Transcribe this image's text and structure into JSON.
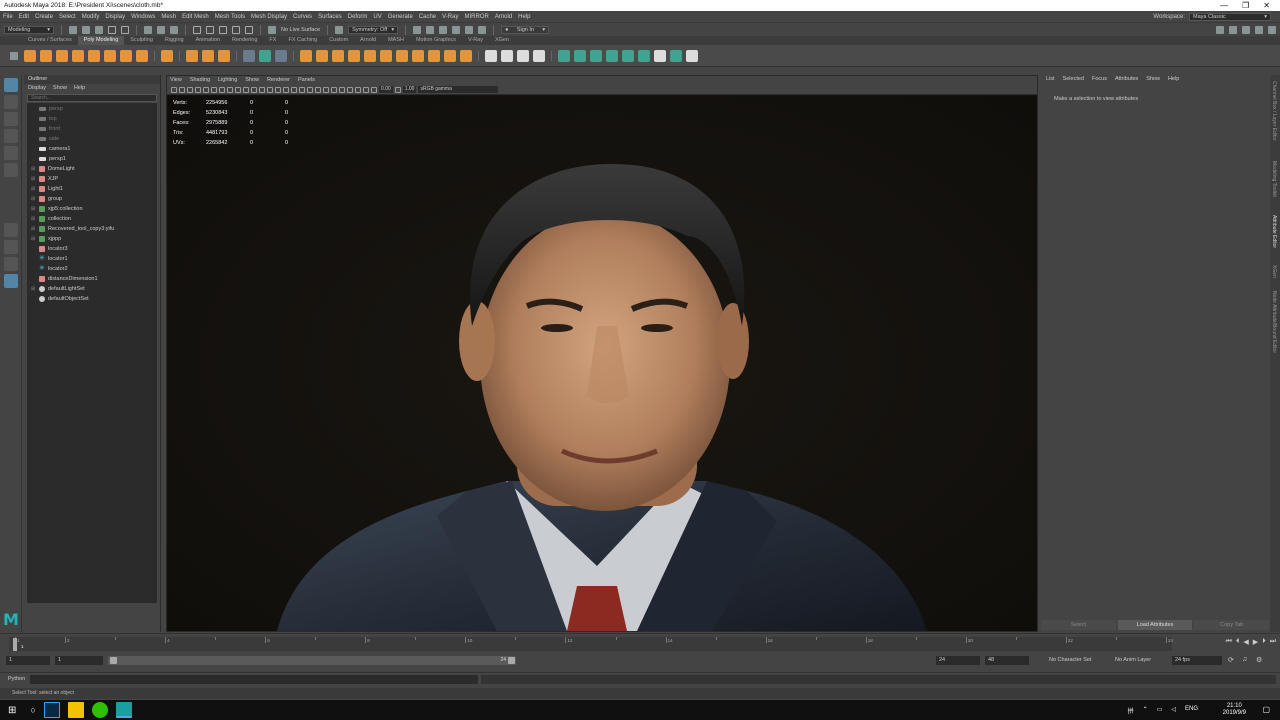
{
  "window": {
    "title": "Autodesk Maya 2018: E:\\President Xi\\scenes\\cloth.mb*",
    "controls": [
      "—",
      "❐",
      "✕"
    ]
  },
  "menubar": {
    "items": [
      "File",
      "Edit",
      "Create",
      "Select",
      "Modify",
      "Display",
      "Windows",
      "Mesh",
      "Edit Mesh",
      "Mesh Tools",
      "Mesh Display",
      "Curves",
      "Surfaces",
      "Deform",
      "UV",
      "Generate",
      "Cache",
      "V-Ray",
      "MIRROR",
      "Arnold",
      "Help"
    ],
    "workspace_label": "Workspace:",
    "workspace_value": "Maya Classic"
  },
  "statusline": {
    "mode": "Modeling",
    "live_surface": "No Live Surface",
    "symmetry": "Symmetry: Off",
    "sign_in": "Sign In"
  },
  "shelf": {
    "tabs": [
      "Curves / Surfaces",
      "Poly Modeling",
      "Sculpting",
      "Rigging",
      "Animation",
      "Rendering",
      "FX",
      "FX Caching",
      "Custom",
      "Arnold",
      "MASH",
      "Motion Graphics",
      "V-Ray",
      "XGen"
    ],
    "active_tab": 1
  },
  "outliner": {
    "title": "Outliner",
    "menu": [
      "Display",
      "Show",
      "Help"
    ],
    "search_placeholder": "Search...",
    "items": [
      {
        "label": "persp",
        "kind": "cam-dim",
        "expand": ""
      },
      {
        "label": "top",
        "kind": "cam-dim",
        "expand": ""
      },
      {
        "label": "front",
        "kind": "cam-dim",
        "expand": ""
      },
      {
        "label": "side",
        "kind": "cam-dim",
        "expand": ""
      },
      {
        "label": "camera1",
        "kind": "cam",
        "expand": ""
      },
      {
        "label": "persp1",
        "kind": "cam",
        "expand": ""
      },
      {
        "label": "DomeLight",
        "kind": "light",
        "expand": "⊞"
      },
      {
        "label": "XJP",
        "kind": "light",
        "expand": "⊞"
      },
      {
        "label": "Light1",
        "kind": "light",
        "expand": "⊞"
      },
      {
        "label": "group",
        "kind": "light",
        "expand": "⊞"
      },
      {
        "label": "xjp5:collection",
        "kind": "group",
        "expand": "⊞"
      },
      {
        "label": "collection",
        "kind": "group",
        "expand": "⊞"
      },
      {
        "label": "Recovered_tool_copy3:yifu",
        "kind": "group",
        "expand": "⊞"
      },
      {
        "label": "xjppp",
        "kind": "group",
        "expand": "⊞"
      },
      {
        "label": "locator3",
        "kind": "light",
        "expand": ""
      },
      {
        "label": "locator1",
        "kind": "locator",
        "expand": ""
      },
      {
        "label": "locator2",
        "kind": "locator",
        "expand": ""
      },
      {
        "label": "distanceDimension1",
        "kind": "light",
        "expand": ""
      },
      {
        "label": "defaultLightSet",
        "kind": "set",
        "expand": "⊞"
      },
      {
        "label": "defaultObjectSet",
        "kind": "set",
        "expand": ""
      }
    ]
  },
  "viewport": {
    "menu": [
      "View",
      "Shading",
      "Lighting",
      "Show",
      "Renderer",
      "Panels"
    ],
    "exposure": "0.00",
    "gamma": "1.00",
    "colorspace": "sRGB gamma",
    "hud": [
      {
        "label": "Verts:",
        "v1": "2254956",
        "v2": "0",
        "v3": "0"
      },
      {
        "label": "Edges:",
        "v1": "5230843",
        "v2": "0",
        "v3": "0"
      },
      {
        "label": "Faces:",
        "v1": "2975889",
        "v2": "0",
        "v3": "0"
      },
      {
        "label": "Tris:",
        "v1": "4481793",
        "v2": "0",
        "v3": "0"
      },
      {
        "label": "UVs:",
        "v1": "2265842",
        "v2": "0",
        "v3": "0"
      }
    ]
  },
  "attribute_editor": {
    "menu": [
      "List",
      "Selected",
      "Focus",
      "Attributes",
      "Show",
      "Help"
    ],
    "message": "Make a selection to view attributes",
    "buttons": [
      "Select",
      "Load Attributes",
      "Copy Tab"
    ],
    "side_tabs": [
      "Channel Box / Layer Editor",
      "Modeling Toolkit",
      "Attribute Editor",
      "XGen",
      "Node Attribute/Bound Editor"
    ]
  },
  "timeline": {
    "ticks": [
      "1",
      "2",
      "4",
      "6",
      "8",
      "10",
      "12",
      "14",
      "16",
      "18",
      "20",
      "22",
      "24"
    ],
    "current": "1",
    "playback": [
      "⏮",
      "⏴",
      "◀",
      "▶",
      "⏵",
      "⏭"
    ]
  },
  "range": {
    "start": "1",
    "start_inner": "1",
    "end_inner": "24",
    "end": "24",
    "end_outer": "48",
    "character_set": "No Character Set",
    "anim_layer": "No Anim Layer",
    "fps": "24 fps"
  },
  "cmdline": {
    "language": "Python"
  },
  "helpline": {
    "text": "Select Tool: select an object"
  },
  "taskbar": {
    "time": "21:10",
    "date": "2019/9/9",
    "lang": "ENG",
    "ime": "拼"
  }
}
